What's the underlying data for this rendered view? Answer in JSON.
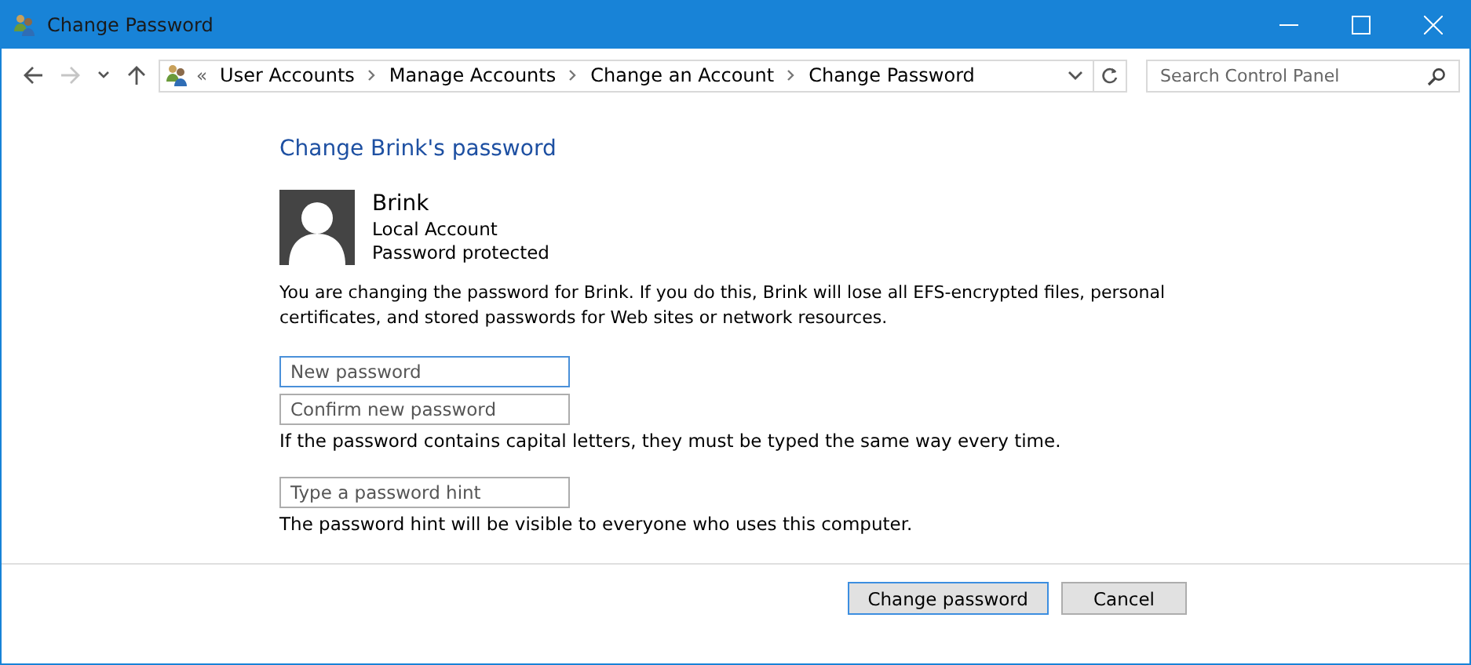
{
  "window": {
    "title": "Change Password"
  },
  "nav": {
    "buttons": [
      {
        "kind": "back",
        "disabled": false
      },
      {
        "kind": "forward",
        "disabled": true
      },
      {
        "kind": "recent",
        "disabled": false
      },
      {
        "kind": "up",
        "disabled": false
      }
    ],
    "breadcrumb": {
      "overflow": "«",
      "items": [
        "User Accounts",
        "Manage Accounts",
        "Change an Account",
        "Change Password"
      ]
    },
    "search": {
      "placeholder": "Search Control Panel"
    }
  },
  "heading": "Change Brink's password",
  "account": {
    "name": "Brink",
    "type": "Local Account",
    "status": "Password protected"
  },
  "warning": "You are changing the password for Brink.  If you do this, Brink will lose all EFS-encrypted files, personal certificates, and stored passwords for Web sites or network resources.",
  "fields": [
    {
      "placeholder": "New password",
      "focused": true
    },
    {
      "placeholder": "Confirm new password",
      "focused": false,
      "note": "If the password contains capital letters, they must be typed the same way every time."
    },
    {
      "placeholder": "Type a password hint",
      "focused": false,
      "note": "The password hint will be visible to everyone who uses this computer."
    }
  ],
  "buttons": [
    {
      "label": "Change password",
      "default": true
    },
    {
      "label": "Cancel",
      "default": false
    }
  ]
}
